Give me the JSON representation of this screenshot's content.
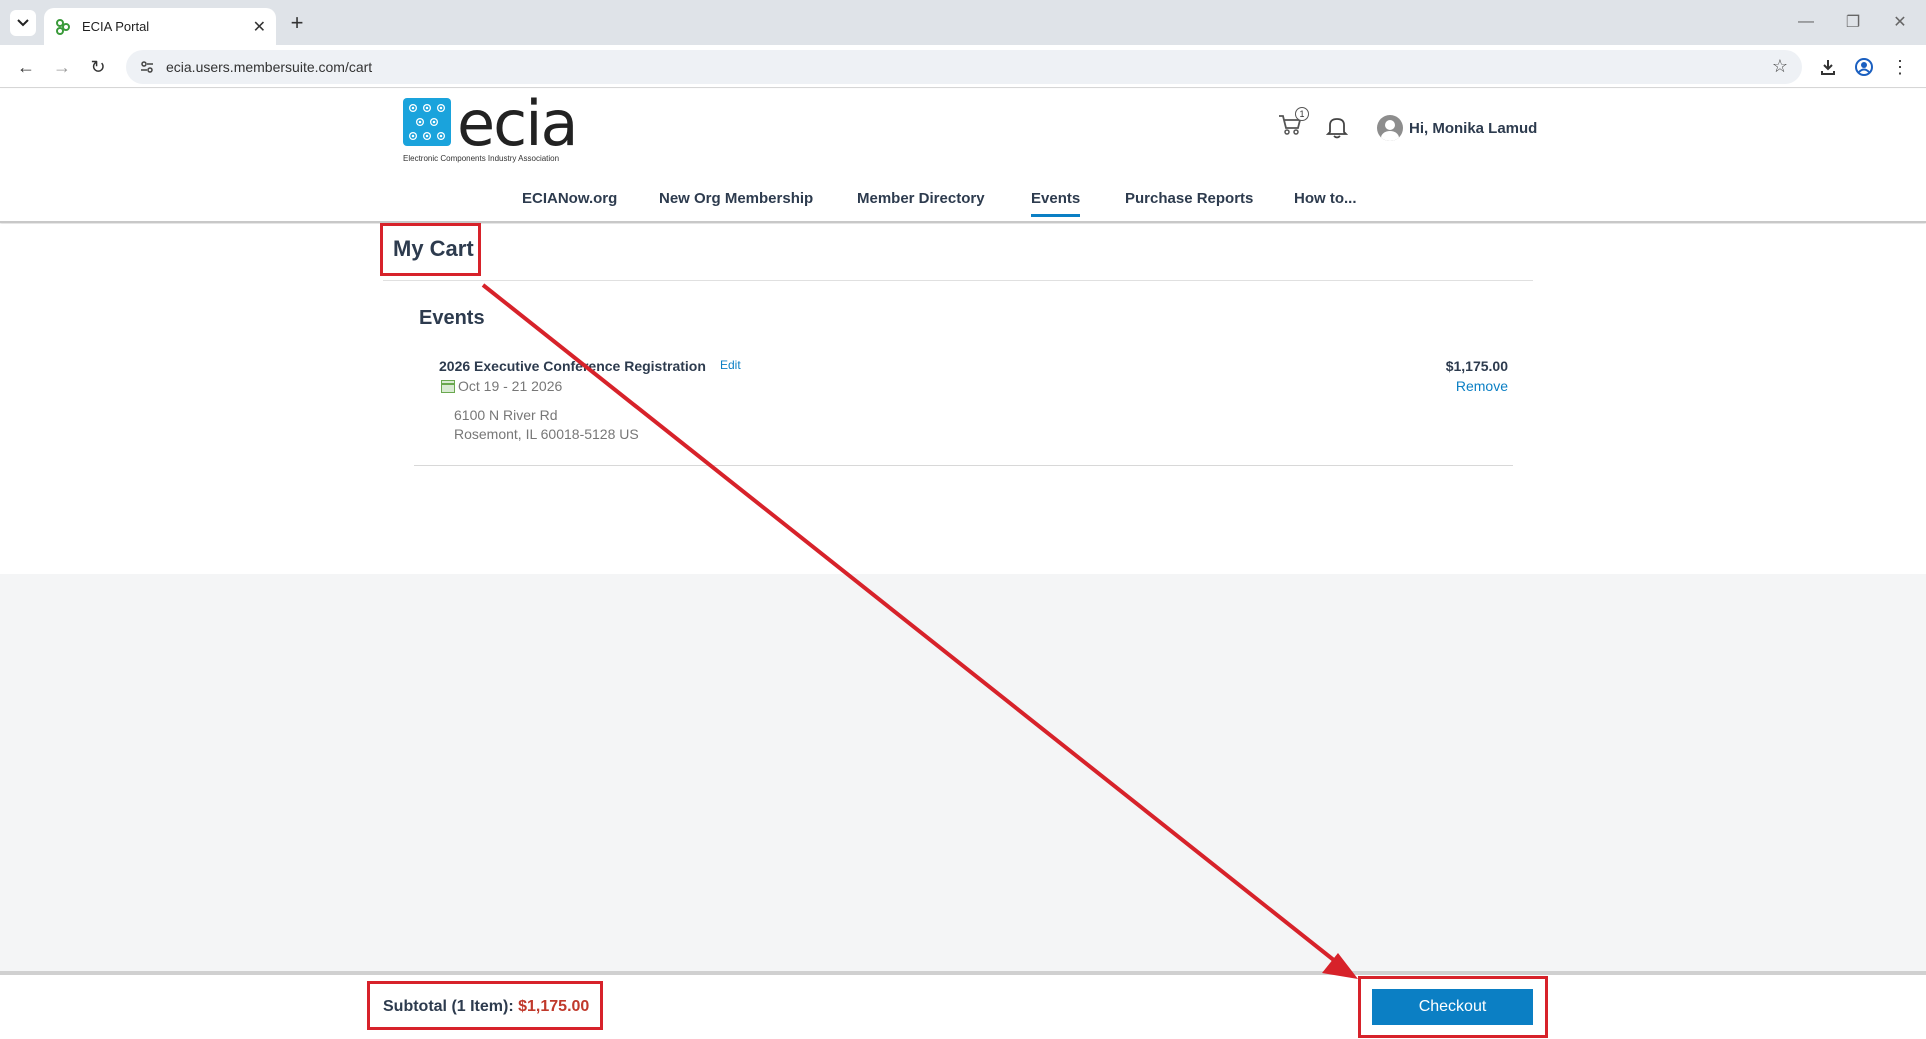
{
  "browser": {
    "tab_title": "ECIA Portal",
    "url": "ecia.users.membersuite.com/cart"
  },
  "site": {
    "logo_text": "ecia",
    "logo_subtitle": "Electronic Components Industry Association",
    "cart_count": "1",
    "greeting": "Hi, Monika Lamud",
    "nav": [
      {
        "label": "ECIANow.org"
      },
      {
        "label": "New Org Membership"
      },
      {
        "label": "Member Directory"
      },
      {
        "label": "Events"
      },
      {
        "label": "Purchase Reports"
      },
      {
        "label": "How to..."
      }
    ],
    "active_nav": "Events"
  },
  "cart": {
    "title": "My Cart",
    "section_title": "Events",
    "item": {
      "name": "2026 Executive Conference Registration",
      "edit_label": "Edit",
      "dates": "Oct 19 - 21 2026",
      "address_line1": "6100 N River Rd",
      "address_line2": "Rosemont, IL 60018-5128 US",
      "price": "$1,175.00",
      "remove_label": "Remove"
    },
    "subtotal_label": "Subtotal (1 Item):",
    "subtotal_amount": "$1,175.00",
    "checkout_label": "Checkout"
  },
  "colors": {
    "accent": "#0b7fc4",
    "annotation": "#d7222a",
    "price_highlight": "#c0392b",
    "brand_blue": "#1aa3dc"
  }
}
